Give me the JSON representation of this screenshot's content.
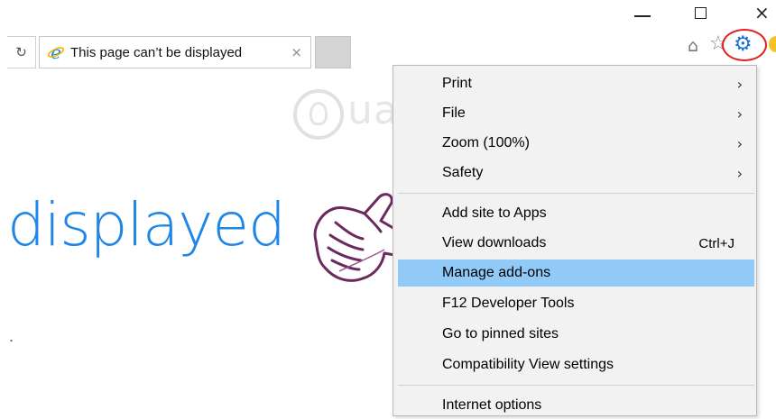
{
  "window": {
    "minimize_glyph": "",
    "maximize_glyph": "",
    "close_glyph": "×"
  },
  "tab": {
    "refresh_glyph": "↻",
    "title": "This page can’t be displayed",
    "close_glyph": "×"
  },
  "toolbar": {
    "home_glyph": "⌂",
    "favorites_glyph": "☆",
    "tools_glyph": "⚙"
  },
  "page": {
    "heading_fragment": "displayed",
    "dot": "."
  },
  "watermark": {
    "text": "uantrimang"
  },
  "menu": {
    "items": [
      {
        "label": "Print",
        "shortcut": "",
        "submenu": true
      },
      {
        "label": "File",
        "shortcut": "",
        "submenu": true
      },
      {
        "label": "Zoom (100%)",
        "shortcut": "",
        "submenu": true
      },
      {
        "label": "Safety",
        "shortcut": "",
        "submenu": true
      },
      {
        "label": "Add site to Apps",
        "shortcut": "",
        "submenu": false
      },
      {
        "label": "View downloads",
        "shortcut": "Ctrl+J",
        "submenu": false
      },
      {
        "label": "Manage add-ons",
        "shortcut": "",
        "submenu": false,
        "highlighted": true
      },
      {
        "label": "F12 Developer Tools",
        "shortcut": "",
        "submenu": false
      },
      {
        "label": "Go to pinned sites",
        "shortcut": "",
        "submenu": false
      },
      {
        "label": "Compatibility View settings",
        "shortcut": "",
        "submenu": false
      },
      {
        "label": "Internet options",
        "shortcut": "",
        "submenu": false
      }
    ],
    "submenu_arrow": "›"
  },
  "colors": {
    "accent_blue": "#1f86e8",
    "highlight": "#91c9f7",
    "gear_blue": "#1a6fd4",
    "annotation_red": "#e02020",
    "hand_purple": "#6b2a5e"
  }
}
